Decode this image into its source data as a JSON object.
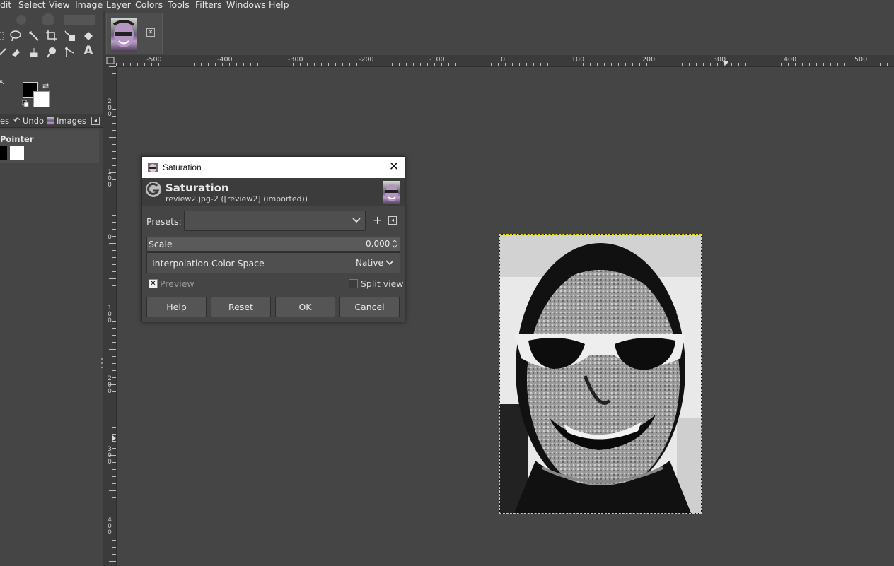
{
  "menubar": {
    "items": [
      "dit",
      "Select",
      "View",
      "Image",
      "Layer",
      "Colors",
      "Tools",
      "Filters",
      "Windows",
      "Help"
    ]
  },
  "toolbox": {
    "dock_tabs": {
      "partial": "es",
      "undo": "Undo",
      "images": "Images"
    },
    "pointer_label": "Pointer"
  },
  "rulers": {
    "horizontal": [
      "-500",
      "-400",
      "-300",
      "-200",
      "-100",
      "0",
      "100",
      "200",
      "300",
      "400",
      "500"
    ],
    "vertical": [
      "200",
      "100",
      "0",
      "100",
      "200",
      "300",
      "400"
    ]
  },
  "dialog": {
    "window_title": "Saturation",
    "header_title": "Saturation",
    "header_subtitle": "review2.jpg-2 ([review2] (imported))",
    "presets_label": "Presets:",
    "presets_value": "",
    "scale_label": "Scale",
    "scale_value": "0.000",
    "interp_label": "Interpolation Color Space",
    "interp_value": "Native",
    "preview_label": "Preview",
    "preview_checked": true,
    "split_view_label": "Split view",
    "split_view_checked": false,
    "buttons": {
      "help": "Help",
      "reset": "Reset",
      "ok": "OK",
      "cancel": "Cancel"
    }
  },
  "colors": {
    "background": "#454545",
    "selection_border": "#e6e600",
    "foreground": "#000000",
    "background_swatch": "#ffffff"
  }
}
